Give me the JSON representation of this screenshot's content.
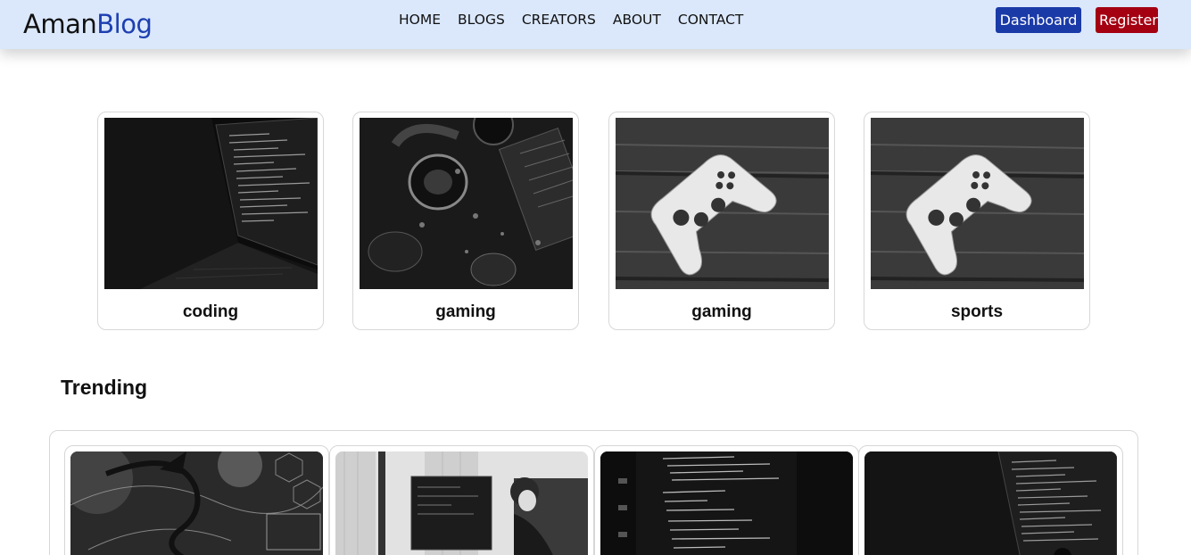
{
  "brand": {
    "part1": "Aman",
    "part2": "Blog"
  },
  "nav": {
    "links": [
      "HOME",
      "BLOGS",
      "CREATORS",
      "ABOUT",
      "CONTACT"
    ],
    "dashboard_label": "Dashboard",
    "register_label": "Register"
  },
  "colors": {
    "header_bg": "#dbe8fc",
    "brand_accent": "#1d3fb0",
    "dashboard_btn": "#1a3aa8",
    "register_btn": "#a40012"
  },
  "categories": [
    {
      "label": "coding",
      "image": "laptop-code-photo"
    },
    {
      "label": "gaming",
      "image": "gaming-headset-photo"
    },
    {
      "label": "gaming",
      "image": "game-controller-photo"
    },
    {
      "label": "sports",
      "image": "game-controller-photo"
    }
  ],
  "trending": {
    "title": "Trending",
    "items": [
      {
        "image": "cyber-dragon-photo"
      },
      {
        "image": "woman-at-monitors-photo"
      },
      {
        "image": "code-screen-photo"
      },
      {
        "image": "laptop-code-photo"
      }
    ]
  }
}
